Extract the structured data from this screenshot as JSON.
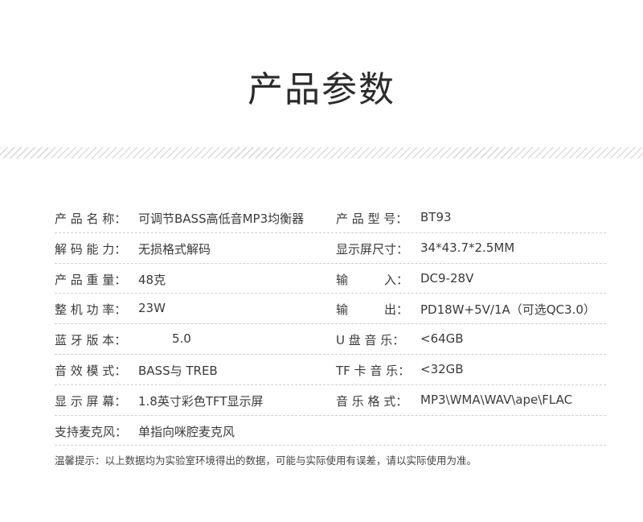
{
  "title": "产品参数",
  "specs": [
    {
      "label_left": "产 品 名 称：",
      "value_left": "可调节BASS高低音MP3均衡器",
      "label_right": "产 品 型 号：",
      "value_right": "BT93"
    },
    {
      "label_left": "解 码 能 力：",
      "value_left": "无损格式解码",
      "label_right": "显示屏尺寸：",
      "value_right": "34*43.7*2.5MM"
    },
    {
      "label_left": "产 品 重 量：",
      "value_left": "48克",
      "label_right": "输　　　入：",
      "value_right": "DC9-28V"
    },
    {
      "label_left": "整 机 功 率：",
      "value_left": "23W",
      "label_right": "输　　　出：",
      "value_right": "PD18W+5V/1A（可选QC3.0）"
    },
    {
      "label_left": "蓝 牙 版 本：",
      "value_left": "5.0",
      "label_right": "U 盘 音 乐：",
      "value_right": "<64GB"
    },
    {
      "label_left": "音 效 模 式：",
      "value_left": "BASS与 TREB",
      "label_right": "TF 卡 音 乐：",
      "value_right": "<32GB"
    },
    {
      "label_left": "显 示 屏 幕：",
      "value_left": "1.8英寸彩色TFT显示屏",
      "label_right": "音 乐 格 式：",
      "value_right": "MP3\\WMA\\WAV\\ape\\FLAC"
    },
    {
      "label_left": "支持麦克风：",
      "value_left": "单指向咪腔麦克风"
    }
  ],
  "note": "温馨提示：以上数据均为实验室环境得出的数据，可能与实际使用有误差，请以实际使用为准。"
}
